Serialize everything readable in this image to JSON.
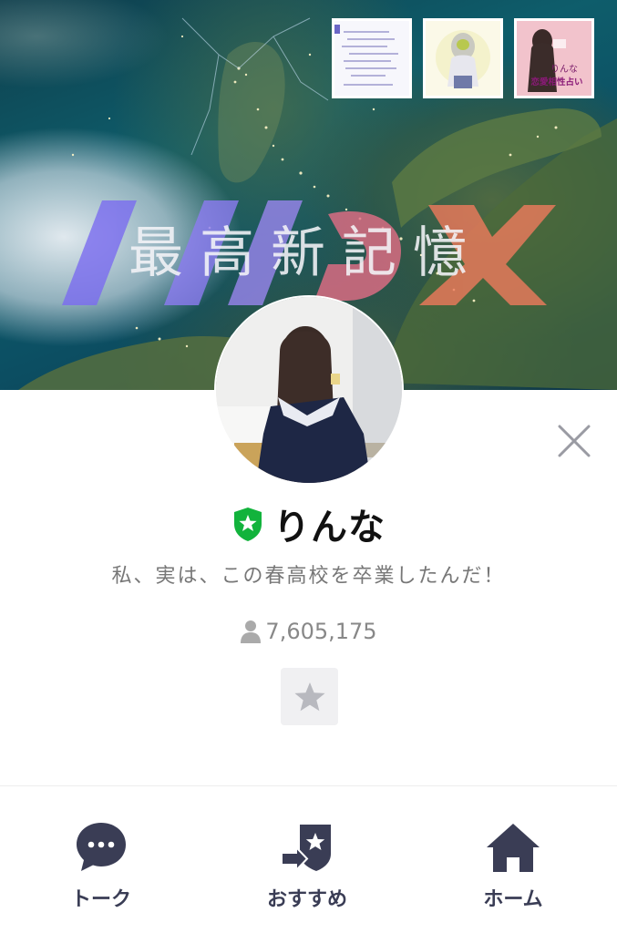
{
  "cover": {
    "headline": "最高新記憶",
    "thumbnails": [
      {
        "kind": "text-note"
      },
      {
        "kind": "illustration"
      },
      {
        "kind": "promo",
        "caption_line1": "りんな",
        "caption_line2": "恋愛相性占い"
      }
    ]
  },
  "profile": {
    "name": "りんな",
    "badge_icon": "official-shield-star-icon",
    "status_message": "私、実は、この春高校を卒業したんだ！",
    "friend_count": "7,605,175",
    "friend_icon": "person-icon",
    "favorite_icon": "star-icon"
  },
  "close_icon": "close-x-icon",
  "actions": [
    {
      "label": "トーク",
      "icon": "speech-bubble-icon"
    },
    {
      "label": "おすすめ",
      "icon": "recommend-share-icon"
    },
    {
      "label": "ホーム",
      "icon": "home-icon"
    }
  ],
  "colors": {
    "badge_green": "#12b33c",
    "action_navy": "#3a3d55",
    "text_gray": "#777777",
    "fav_bg": "#f0f0f2",
    "fav_star": "#b8b9bf"
  }
}
